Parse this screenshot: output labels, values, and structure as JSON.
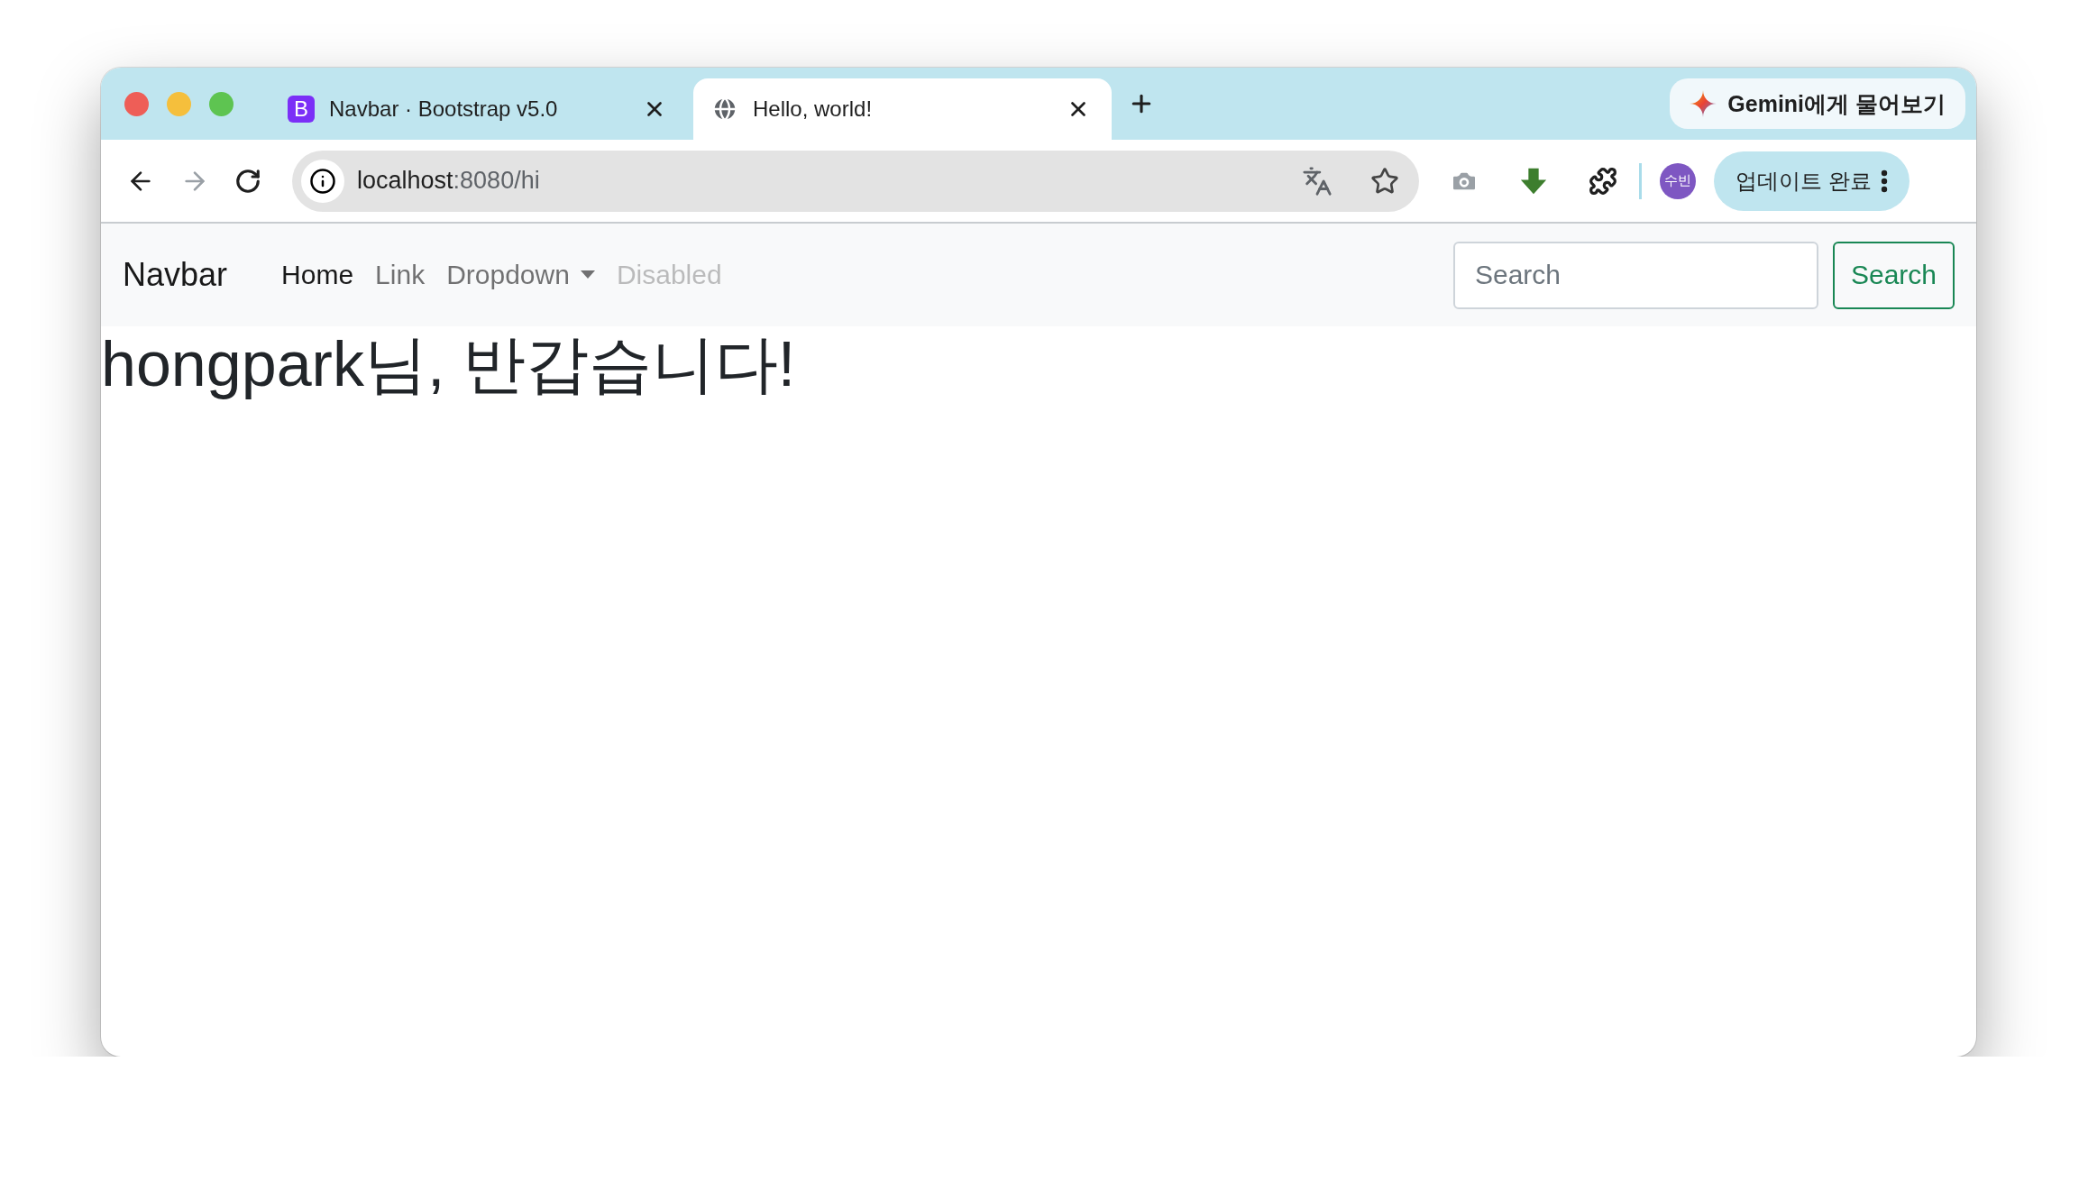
{
  "browser": {
    "tabs": [
      {
        "title": "Navbar · Bootstrap v5.0",
        "favicon": "B",
        "selected": false
      },
      {
        "title": "Hello, world!",
        "selected": true
      }
    ],
    "gemini_button": "Gemini에게 물어보기",
    "forward_disabled": true,
    "address": {
      "host": "localhost",
      "path": ":8080/hi"
    },
    "profile": "수빈",
    "update_button": "업데이트 완료"
  },
  "navbar": {
    "brand": "Navbar",
    "links": [
      {
        "label": "Home",
        "kind": "link",
        "selected": true,
        "disabled": false
      },
      {
        "label": "Link",
        "kind": "link",
        "selected": false,
        "disabled": false
      },
      {
        "label": "Dropdown",
        "kind": "dropdown",
        "selected": false,
        "disabled": false
      },
      {
        "label": "Disabled",
        "kind": "link",
        "selected": false,
        "disabled": true
      }
    ],
    "search": {
      "placeholder": "Search",
      "button": "Search"
    }
  },
  "heading": "hongpark님, 반갑습니다!"
}
